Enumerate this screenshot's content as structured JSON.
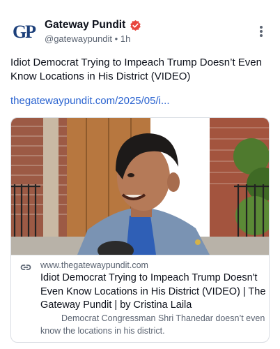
{
  "author": {
    "avatar_text": "GP",
    "name": "Gateway Pundit",
    "handle": "@gatewaypundit",
    "separator": "•",
    "time": "1h"
  },
  "post": {
    "text": "Idiot Democrat Trying to Impeach Trump Doesn’t Even Know Locations in His District (VIDEO)",
    "link": "thegatewaypundit.com/2025/05/i..."
  },
  "card": {
    "domain": "www.thegatewaypundit.com",
    "title": "Idiot Democrat Trying to Impeach Trump Doesn't Even Know Locations in His District (VIDEO) | The Gateway Pundit | by Cristina Laila",
    "description": "Democrat Congressman Shri Thanedar doesn’t even know the locations in his district."
  },
  "colors": {
    "link": "#2a63d0",
    "verified_badge": "#e8453c",
    "logo": "#1c3f7a"
  },
  "icons": [
    "verified-badge-icon",
    "more-vertical-icon",
    "link-icon"
  ]
}
